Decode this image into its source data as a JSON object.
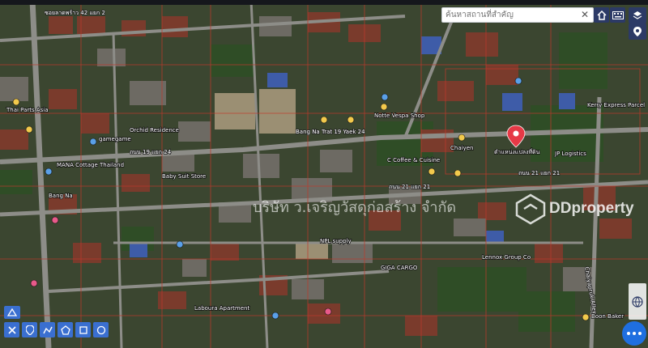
{
  "search": {
    "placeholder": "ค้นหาสถานที่สำคัญ",
    "clear_glyph": "✕"
  },
  "watermark": {
    "company_text": "บริษัท ว.เจริญวัสดุก่อสร้าง จำกัด",
    "brand_text": "DDproperty"
  },
  "target_label": "ตำแหน่งแปลงที่ดิน",
  "colors": {
    "road": "#8d8d88",
    "parcel_line": "#c0392b",
    "button": "#2c3a66",
    "tool_button": "#3a6fd0",
    "pin": "#e63946",
    "vegetation": "#2f4d26",
    "roof": "#7a3b2c"
  },
  "road_labels": [
    {
      "text": "ซอยลาดพร้าว 42 แยก 2",
      "icon": "road-label"
    },
    {
      "text": "ถนน 19 แยก 24",
      "icon": "road-label"
    },
    {
      "text": "Bang Na Trat 19 Yaek 24",
      "icon": "road-label"
    },
    {
      "text": "ถนน 21 แยก 21",
      "icon": "road-label"
    },
    {
      "text": "ถนน 21 แยก 21",
      "icon": "road-label"
    },
    {
      "text": "Chaiyapruk Alley",
      "icon": "road-label"
    }
  ],
  "places": [
    {
      "text": "Orchid Residence"
    },
    {
      "text": "Notte Vespa Shop"
    },
    {
      "text": "Chaiyen"
    },
    {
      "text": "C Coffee & Cuisine"
    },
    {
      "text": "Kerry Express Parcel"
    },
    {
      "text": "JP Logistics"
    },
    {
      "text": "gamegame"
    },
    {
      "text": "MANA Cottage Thailand"
    },
    {
      "text": "Baby Suit Store"
    },
    {
      "text": "Lennox Group Co"
    },
    {
      "text": "GIGA CARGO"
    },
    {
      "text": "Laboura Apartment"
    },
    {
      "text": "Boon Baker"
    },
    {
      "text": "Bang Na"
    },
    {
      "text": "Thai Parts Asia"
    },
    {
      "text": "NPL supply"
    }
  ],
  "controls": {
    "top": [
      "home-icon",
      "keyboard-icon",
      "layers-icon"
    ],
    "right": [
      "pin-icon",
      "globe-icon"
    ],
    "tools": [
      "measure-distance-icon",
      "marker-icon",
      "polyline-icon",
      "polygon-icon",
      "rectangle-icon",
      "circle-icon"
    ],
    "bottom_left": "info-icon"
  }
}
